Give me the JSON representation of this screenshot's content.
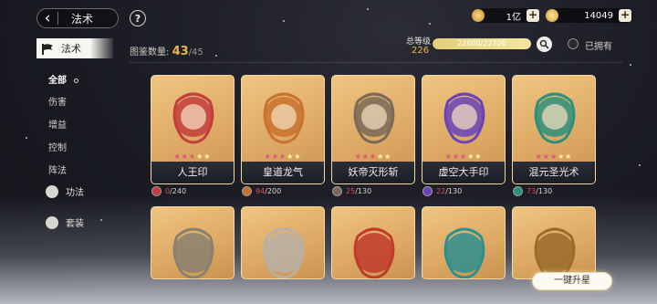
{
  "header": {
    "back_title": "法术",
    "help_symbol": "?",
    "resources": [
      {
        "icon": "coin-icon",
        "value": "1亿",
        "color": "#e2a33a"
      },
      {
        "icon": "gem-icon",
        "value": "14049",
        "color": "#e8b84e"
      }
    ]
  },
  "sidebar": {
    "active_tab": "法术",
    "items": [
      {
        "label": "全部",
        "active": true
      },
      {
        "label": "伤害",
        "active": false
      },
      {
        "label": "增益",
        "active": false
      },
      {
        "label": "控制",
        "active": false
      },
      {
        "label": "阵法",
        "active": false
      }
    ],
    "categories": [
      {
        "label": "功法",
        "icon": "lotus-icon"
      },
      {
        "label": "套装",
        "icon": "armor-icon"
      }
    ]
  },
  "collection": {
    "label": "图鉴数量:",
    "current": "43",
    "total": "/45"
  },
  "level": {
    "label": "总等级",
    "value": "226",
    "progress_text": "22600/22700",
    "progress_fraction": 0.9956
  },
  "filter": {
    "owned_label": "已拥有"
  },
  "cards": [
    {
      "name": "人王印",
      "stars_red": 3,
      "stars_gold": 2,
      "progress_current": "0",
      "progress_total": "/240",
      "theme": "#c33d3d"
    },
    {
      "name": "皇道龙气",
      "stars_red": 3,
      "stars_gold": 2,
      "progress_current": "94",
      "progress_total": "/200",
      "theme": "#c9722e"
    },
    {
      "name": "妖帝灭形斩",
      "stars_red": 3,
      "stars_gold": 2,
      "progress_current": "25",
      "progress_total": "/130",
      "theme": "#7a6a58"
    },
    {
      "name": "虚空大手印",
      "stars_red": 3,
      "stars_gold": 2,
      "progress_current": "22",
      "progress_total": "/130",
      "theme": "#6a43b8"
    },
    {
      "name": "混元圣光术",
      "stars_red": 3,
      "stars_gold": 2,
      "progress_current": "73",
      "progress_total": "/130",
      "theme": "#2f8f7c"
    }
  ],
  "second_row_themes": [
    "#8a8070",
    "#b7b0a6",
    "#c0392b",
    "#2e8f8f",
    "#9a6b2a"
  ],
  "upgrade_button": "一键升星"
}
